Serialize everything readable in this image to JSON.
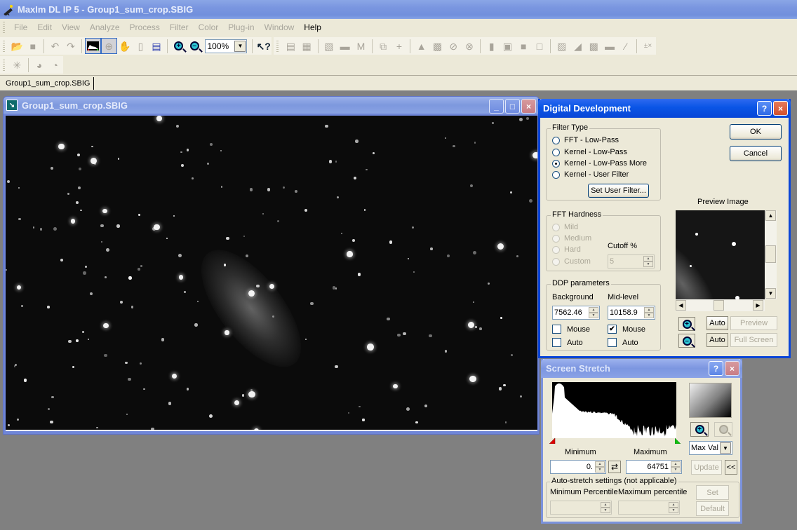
{
  "app": {
    "title": "MaxIm DL IP 5 - Group1_sum_crop.SBIG"
  },
  "menu": [
    {
      "label": "File",
      "enabled": false
    },
    {
      "label": "Edit",
      "enabled": false
    },
    {
      "label": "View",
      "enabled": false
    },
    {
      "label": "Analyze",
      "enabled": false
    },
    {
      "label": "Process",
      "enabled": false
    },
    {
      "label": "Filter",
      "enabled": false
    },
    {
      "label": "Color",
      "enabled": false
    },
    {
      "label": "Plug-in",
      "enabled": false
    },
    {
      "label": "Window",
      "enabled": false
    },
    {
      "label": "Help",
      "enabled": true
    }
  ],
  "toolbar": {
    "zoom_value": "100%",
    "icons_row1_left": [
      "open-icon",
      "save-icon",
      "undo-icon",
      "redo-icon",
      "screen-stretch-icon",
      "crosshair-icon",
      "pan-icon",
      "mouse-icon",
      "info-icon",
      "zoom-in-icon",
      "zoom-out-icon"
    ],
    "icons_row1_right": [
      "help-pointer-icon",
      "ruler-icon",
      "report-icon",
      "measure-icon",
      "scale-icon",
      "copy-icon",
      "add-icon",
      "flask-icon",
      "noise-icon",
      "no-filter-icon",
      "filter-icon",
      "chart-icon",
      "stack-icon",
      "overlap-icon",
      "square-icon",
      "gradient-icon",
      "diagonal-icon",
      "checker-icon",
      "bar-icon",
      "curve-icon",
      "math-icon"
    ],
    "icons_row2": [
      "star-icon",
      "dial-icon",
      "dial-checker-icon"
    ]
  },
  "doc_tabs": [
    {
      "label": "Group1_sum_crop.SBIG"
    }
  ],
  "image_window": {
    "title": "Group1_sum_crop.SBIG",
    "minimize": "_",
    "maximize": "□",
    "close": "×"
  },
  "digital_development": {
    "title": "Digital Development",
    "help": "?",
    "close": "×",
    "filter_type": {
      "label": "Filter Type",
      "options": [
        {
          "label": "FFT - Low-Pass",
          "checked": false
        },
        {
          "label": "Kernel - Low-Pass",
          "checked": false
        },
        {
          "label": "Kernel - Low-Pass More",
          "checked": true
        },
        {
          "label": "Kernel - User Filter",
          "checked": false
        }
      ],
      "set_user_filter": "Set User Filter..."
    },
    "ok": "OK",
    "cancel": "Cancel",
    "fft_hardness": {
      "label": "FFT Hardness",
      "options": [
        {
          "label": "Mild"
        },
        {
          "label": "Medium"
        },
        {
          "label": "Hard"
        },
        {
          "label": "Custom"
        }
      ],
      "cutoff_label": "Cutoff %",
      "cutoff_value": "5"
    },
    "ddp": {
      "label": "DDP parameters",
      "background_label": "Background",
      "background_value": "7562.46",
      "midlevel_label": "Mid-level",
      "midlevel_value": "10158.9",
      "bg_mouse": {
        "label": "Mouse",
        "checked": false
      },
      "bg_auto": {
        "label": "Auto",
        "checked": false
      },
      "ml_mouse": {
        "label": "Mouse",
        "checked": true
      },
      "ml_auto": {
        "label": "Auto",
        "checked": false
      }
    },
    "preview": {
      "label": "Preview Image",
      "auto1": "Auto",
      "auto2": "Auto",
      "preview_btn": "Preview",
      "full_screen_btn": "Full Screen"
    }
  },
  "screen_stretch": {
    "title": "Screen Stretch",
    "help": "?",
    "close": "×",
    "minimum_label": "Minimum",
    "minimum_value": "0.",
    "maximum_label": "Maximum",
    "maximum_value": "64751",
    "mode_select": "Max Val",
    "update": "Update",
    "collapse": "<<",
    "auto_stretch": {
      "label": "Auto-stretch settings (not applicable)",
      "min_pct_label": "Minimum Percentile",
      "max_pct_label": "Maximum percentile",
      "set": "Set",
      "default": "Default"
    }
  }
}
